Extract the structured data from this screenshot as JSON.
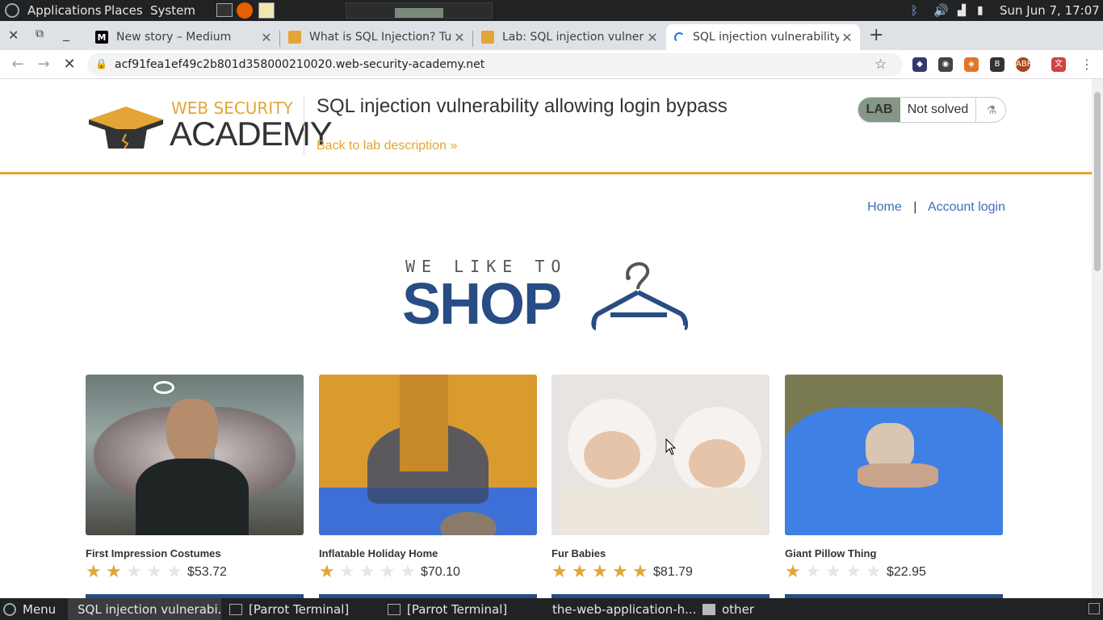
{
  "os_bar": {
    "menus": [
      "Applications",
      "Places",
      "System"
    ],
    "clock": "Sun Jun 7, 17:07"
  },
  "browser": {
    "tabs": [
      {
        "title": "New story – Medium",
        "favicon": "M"
      },
      {
        "title": "What is SQL Injection? Tu",
        "favicon": "doc-orange"
      },
      {
        "title": "Lab: SQL injection vulnera",
        "favicon": "doc-orange"
      },
      {
        "title": "SQL injection vulnerability",
        "favicon": "loading-spinner",
        "active": true
      }
    ],
    "new_tab": "+",
    "url": "acf91fea1ef49c2b801d358000210020.web-security-academy.net"
  },
  "academy": {
    "logo_top": "WEB SECURITY",
    "logo_bottom": "ACADEMY",
    "lab_title": "SQL injection vulnerability allowing login bypass",
    "back_link": "Back to lab description",
    "lab_badge": "LAB",
    "lab_state": "Not solved"
  },
  "nav": {
    "home": "Home",
    "separator": "|",
    "account": "Account login"
  },
  "shop": {
    "tagline": "WE LIKE TO",
    "title": "SHOP"
  },
  "products": [
    {
      "name": "First Impression Costumes",
      "rating": 2,
      "price": "$53.72"
    },
    {
      "name": "Inflatable Holiday Home",
      "rating": 1,
      "price": "$70.10"
    },
    {
      "name": "Fur Babies",
      "rating": 5,
      "price": "$81.79"
    },
    {
      "name": "Giant Pillow Thing",
      "rating": 1,
      "price": "$22.95"
    }
  ],
  "taskbar": {
    "menu": "Menu",
    "tasks": [
      "SQL injection vulnerabi...",
      "[Parrot Terminal]",
      "[Parrot Terminal]",
      "the-web-application-h...",
      "other"
    ]
  },
  "colors": {
    "academy_orange": "#e3a535",
    "shop_blue": "#284c84",
    "link_blue": "#3c6fb6",
    "lab_green": "#849684"
  }
}
